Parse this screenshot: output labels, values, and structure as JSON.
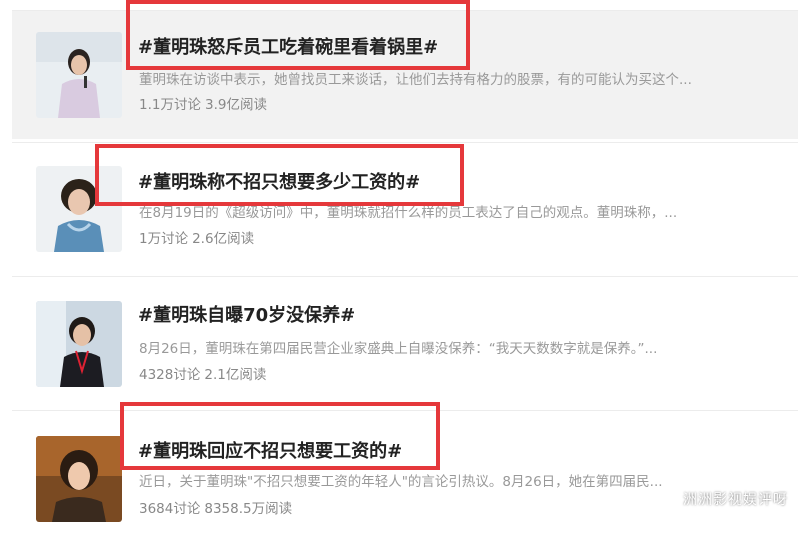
{
  "topics": [
    {
      "title": "#董明珠怒斥员工吃着碗里看着锅里#",
      "desc": "董明珠在访谈中表示，她曾找员工来谈话，让他们去持有格力的股票，有的可能认为买这个...",
      "discussions": "1.1万讨论",
      "reads": "3.9亿阅读"
    },
    {
      "title": "#董明珠称不招只想要多少工资的#",
      "desc": "在8月19日的《超级访问》中，董明珠就招什么样的员工表达了自己的观点。董明珠称，...",
      "discussions": "1万讨论",
      "reads": "2.6亿阅读"
    },
    {
      "title": "#董明珠自曝70岁没保养#",
      "desc": "8月26日，董明珠在第四届民营企业家盛典上自曝没保养：“我天天数数字就是保养。”...",
      "discussions": "4328讨论",
      "reads": "2.1亿阅读"
    },
    {
      "title": "#董明珠回应不招只想要工资的#",
      "desc": "近日，关于董明珠\"不招只想要工资的年轻人\"的言论引热议。8月26日，她在第四届民...",
      "discussions": "3684讨论",
      "reads": "8358.5万阅读"
    }
  ],
  "watermark": "洲洲影视娱评呀",
  "colors": {
    "highlight": "#e5383b",
    "hover_bg": "#f2f2f2",
    "title": "#222222",
    "meta": "#999999"
  }
}
